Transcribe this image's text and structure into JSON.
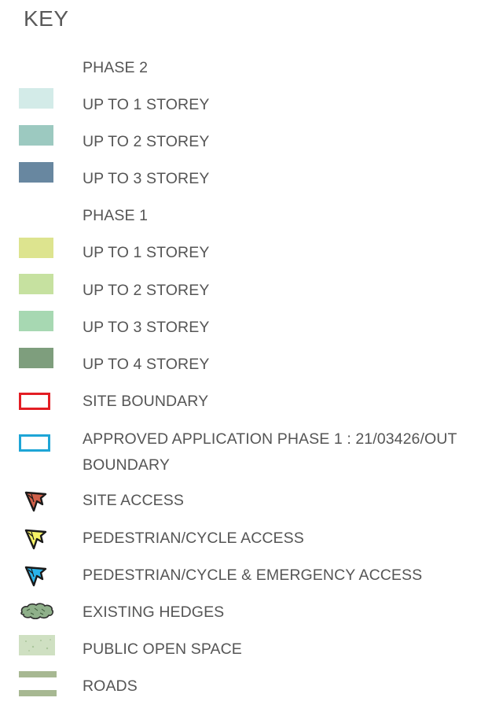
{
  "key": {
    "title": "KEY",
    "phase2": {
      "heading": "PHASE 2",
      "items": [
        {
          "label": "UP TO 1 STOREY",
          "color": "#d3ebe8"
        },
        {
          "label": "UP TO 2 STOREY",
          "color": "#9cc9c0"
        },
        {
          "label": "UP TO 3 STOREY",
          "color": "#6887a0"
        }
      ]
    },
    "phase1": {
      "heading": "PHASE 1",
      "items": [
        {
          "label": "UP TO 1 STOREY",
          "color": "#dde48f"
        },
        {
          "label": "UP TO 2 STOREY",
          "color": "#c6e1a0"
        },
        {
          "label": "UP TO 3 STOREY",
          "color": "#a7d8b2"
        },
        {
          "label": "UP TO 4 STOREY",
          "color": "#7e9e7d"
        }
      ]
    },
    "boundaries": [
      {
        "label": "SITE BOUNDARY",
        "color": "#e31e24"
      },
      {
        "label": "APPROVED APPLICATION PHASE 1 : 21/03426/OUT BOUNDARY",
        "color": "#1ea5d6"
      }
    ],
    "access": [
      {
        "label": "SITE ACCESS",
        "color": "#d0604a",
        "icon": "site-access-arrow-icon"
      },
      {
        "label": "PEDESTRIAN/CYCLE ACCESS",
        "color": "#f6f266",
        "icon": "pedestrian-access-arrow-icon"
      },
      {
        "label": "PEDESTRIAN/CYCLE & EMERGENCY ACCESS",
        "color": "#2ab4ea",
        "icon": "emergency-access-arrow-icon"
      }
    ],
    "features": [
      {
        "label": "EXISTING HEDGES",
        "color": "#8fb08a",
        "icon": "hedge-icon"
      },
      {
        "label": "PUBLIC OPEN SPACE",
        "color": "#cfe0c2",
        "icon": "open-space-swatch"
      },
      {
        "label": "ROADS",
        "color": "#a7b892",
        "icon": "roads-swatch"
      }
    ]
  }
}
